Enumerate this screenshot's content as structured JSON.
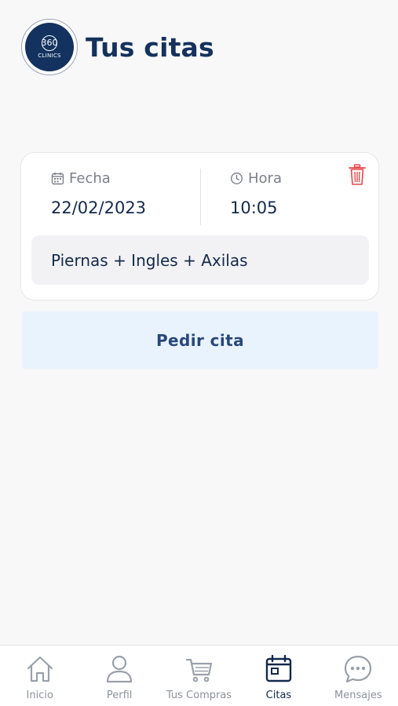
{
  "header": {
    "title": "Tus citas",
    "logo": {
      "line1": "360",
      "line2": "CLINICS"
    }
  },
  "appointment": {
    "fecha_label": "Fecha",
    "fecha_value": "22/02/2023",
    "hora_label": "Hora",
    "hora_value": "10:05",
    "treatment": "Piernas + Ingles + Axilas",
    "delete_icon": "trash-icon"
  },
  "cta": {
    "label": "Pedir cita"
  },
  "tabbar": {
    "items": [
      {
        "label": "Inicio",
        "icon": "home-icon",
        "active": false
      },
      {
        "label": "Perfil",
        "icon": "user-icon",
        "active": false
      },
      {
        "label": "Tus Compras",
        "icon": "cart-icon",
        "active": false
      },
      {
        "label": "Citas",
        "icon": "calendar-icon",
        "active": true
      },
      {
        "label": "Mensajes",
        "icon": "chat-icon",
        "active": false
      }
    ]
  },
  "colors": {
    "brand": "#14325d",
    "cta_bg": "#e8f3fd",
    "delete": "#e5484d",
    "muted": "#7b7f8a"
  }
}
